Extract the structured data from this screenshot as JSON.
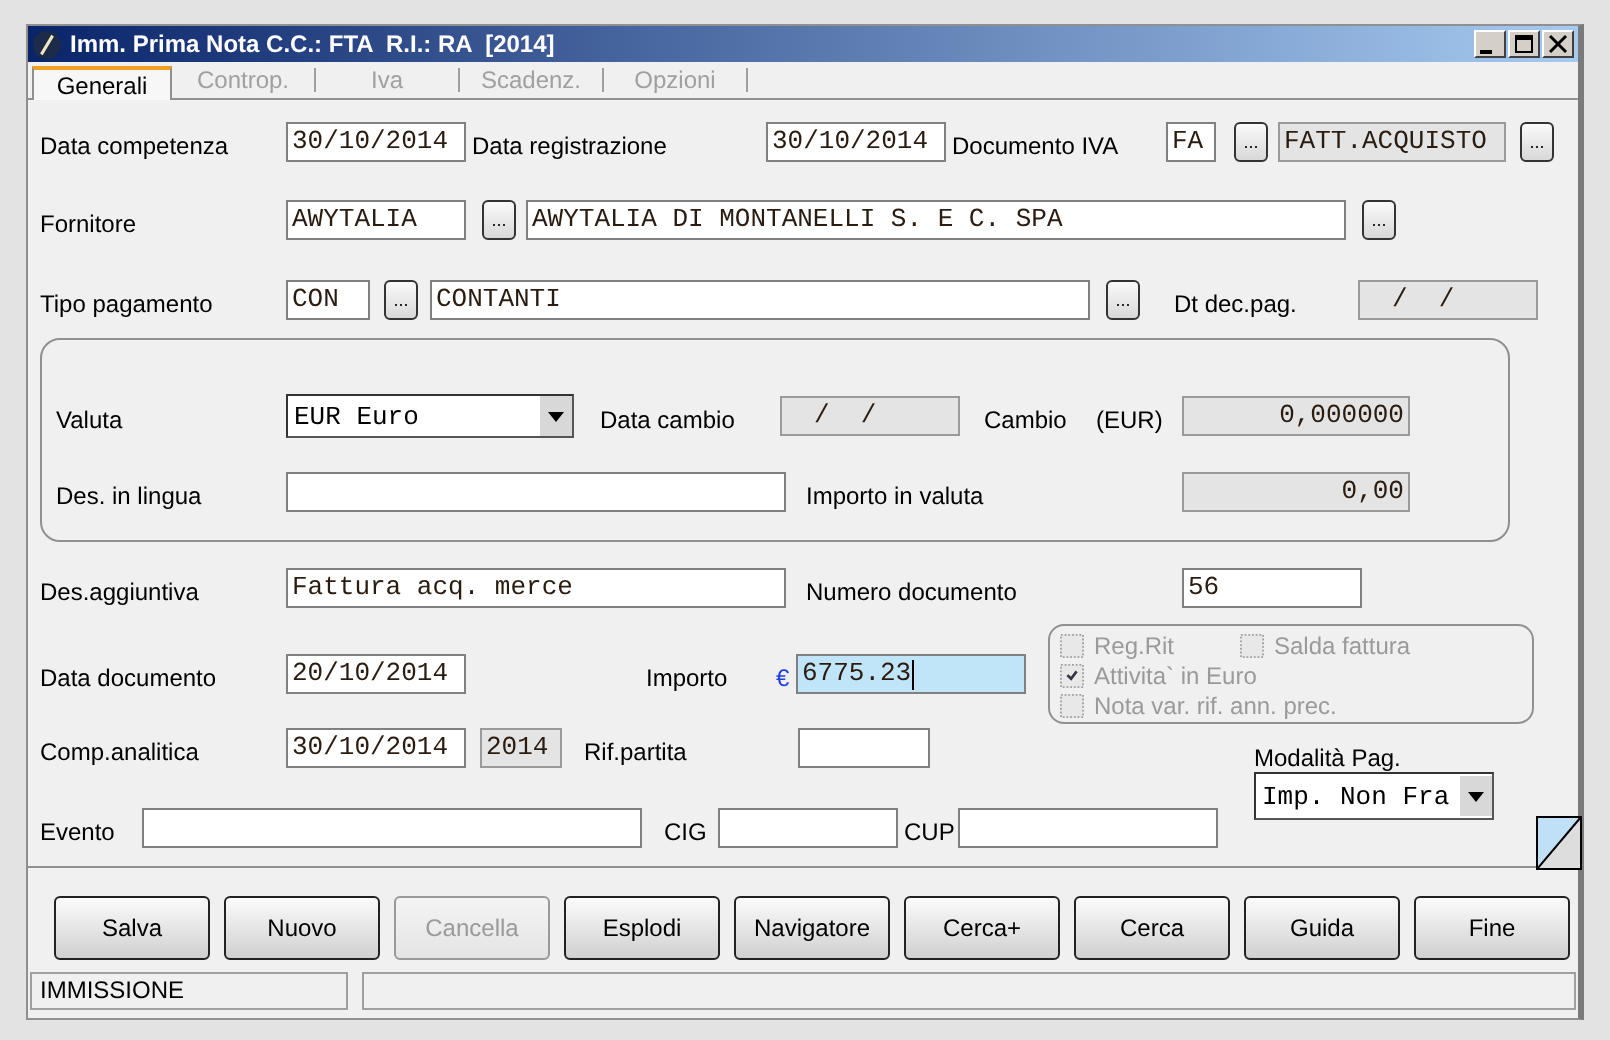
{
  "window": {
    "title": "Imm. Prima Nota C.C.: FTA  R.I.: RA  [2014]"
  },
  "tabs": [
    {
      "label": "Generali",
      "selected": true
    },
    {
      "label": "Controp.",
      "selected": false
    },
    {
      "label": "Iva",
      "selected": false
    },
    {
      "label": "Scadenz.",
      "selected": false
    },
    {
      "label": "Opzioni",
      "selected": false
    }
  ],
  "data_competenza": {
    "label": "Data competenza",
    "value": "30/10/2014",
    "readonly": false
  },
  "data_registrazione": {
    "label": "Data registrazione",
    "value": "30/10/2014",
    "readonly": false
  },
  "documento_iva": {
    "label": "Documento IVA",
    "code": {
      "value": "FA",
      "readonly": false
    },
    "code_picker": "...",
    "description": {
      "value": "FATT.ACQUISTO",
      "readonly": true
    },
    "description_picker": "..."
  },
  "fornitore": {
    "label": "Fornitore",
    "code": {
      "value": "AWYTALIA",
      "readonly": false
    },
    "code_picker": "...",
    "description": {
      "value": "AWYTALIA DI MONTANELLI S. E C. SPA",
      "readonly": false
    },
    "description_picker": "..."
  },
  "tipo_pagamento": {
    "label": "Tipo pagamento",
    "code": {
      "value": "CON",
      "readonly": false
    },
    "code_picker": "...",
    "description": {
      "value": "CONTANTI",
      "readonly": false
    },
    "description_picker": "..."
  },
  "dt_dec_pag": {
    "label": "Dt dec.pag.",
    "value": "/  /",
    "readonly": true
  },
  "currency_group": {
    "valuta": {
      "label": "Valuta",
      "value": "EUR Euro"
    },
    "data_cambio": {
      "label": "Data cambio",
      "value": "/  /",
      "readonly": true
    },
    "cambio": {
      "label": "Cambio",
      "unit": "(EUR)",
      "value": "0,000000",
      "readonly": true
    },
    "des_in_lingua": {
      "label": "Des. in lingua",
      "readonly": false
    },
    "importo_in_valuta": {
      "label": "Importo in valuta",
      "value": "0,00",
      "readonly": true
    }
  },
  "des_aggiuntiva": {
    "label": "Des.aggiuntiva",
    "value": "Fattura acq. merce",
    "readonly": false
  },
  "numero_documento": {
    "label": "Numero documento",
    "value": "56",
    "readonly": false
  },
  "data_documento": {
    "label": "Data documento",
    "value": "20/10/2014",
    "readonly": false
  },
  "importo": {
    "label": "Importo",
    "currency": "€",
    "value": "6775.23",
    "readonly": false,
    "focused": true
  },
  "options": [
    {
      "label": "Reg.Rit",
      "checked": false,
      "disabled": true
    },
    {
      "label": "Salda fattura",
      "checked": false,
      "disabled": true
    },
    {
      "label": "Attivita` in Euro",
      "checked": true,
      "disabled": true
    },
    {
      "label": "Nota var. rif. ann. prec.",
      "checked": false,
      "disabled": true
    }
  ],
  "comp_analitica": {
    "label": "Comp.analitica",
    "value": "30/10/2014",
    "readonly": false,
    "year": {
      "value": "2014",
      "readonly": true
    }
  },
  "rif_partita": {
    "label": "Rif.partita",
    "readonly": false
  },
  "modalita_pag": {
    "label": "Modalità Pag.",
    "value": "Imp. Non Fra"
  },
  "evento": {
    "label": "Evento",
    "readonly": false
  },
  "cig": {
    "label": "CIG",
    "readonly": false
  },
  "cup": {
    "label": "CUP",
    "readonly": false
  },
  "buttons": [
    {
      "label": "Salva",
      "disabled": false
    },
    {
      "label": "Nuovo",
      "disabled": false
    },
    {
      "label": "Cancella",
      "disabled": true
    },
    {
      "label": "Esplodi",
      "disabled": false
    },
    {
      "label": "Navigatore",
      "disabled": false
    },
    {
      "label": "Cerca+",
      "disabled": false
    },
    {
      "label": "Cerca",
      "disabled": false
    },
    {
      "label": "Guida",
      "disabled": false
    },
    {
      "label": "Fine",
      "disabled": false
    }
  ],
  "status_bar": {
    "mode": "IMMISSIONE"
  }
}
